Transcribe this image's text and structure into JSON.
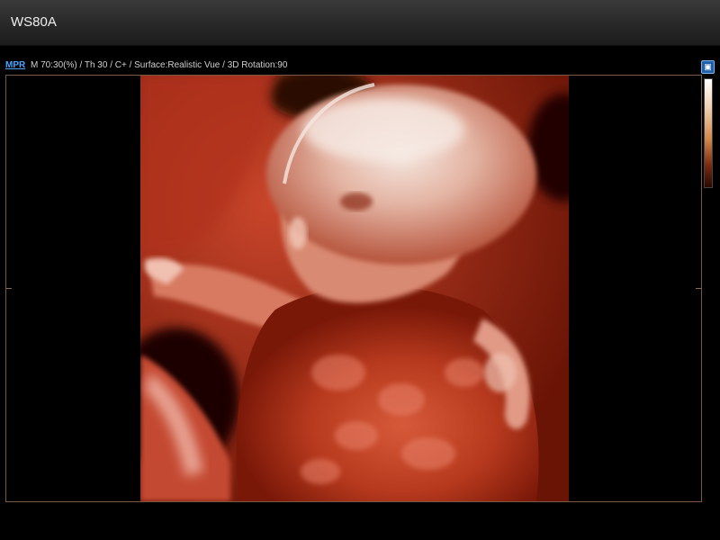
{
  "window": {
    "title": "WS80A"
  },
  "infobar": {
    "mode_button": "MPR",
    "params": "M 70:30(%) / Th 30 / C+ / Surface:Realistic Vue / 3D Rotation:90"
  },
  "colors": {
    "accent": "#4aa3ff",
    "render_base": "#8a1c08",
    "frame": "#7a5a45"
  },
  "icons": {
    "corner_button": "layout-icon"
  }
}
